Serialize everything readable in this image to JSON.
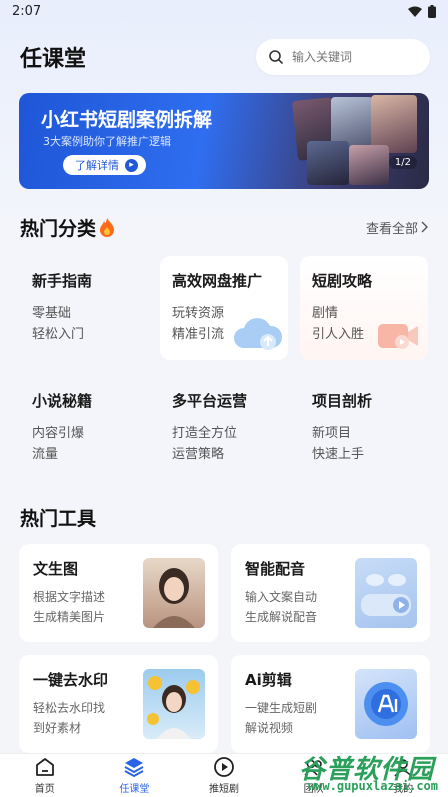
{
  "status_bar": {
    "time": "2:07"
  },
  "header": {
    "title": "任课堂",
    "search_placeholder": "输入关键词"
  },
  "banner": {
    "title": "小红书短剧案例拆解",
    "subtitle": "3大案例助你了解推广逻辑",
    "button_label": "了解详情",
    "pager": "1/2"
  },
  "hot_categories": {
    "title": "热门分类",
    "see_all": "查看全部",
    "items": [
      {
        "title": "新手指南",
        "line1": "零基础",
        "line2": "轻松入门"
      },
      {
        "title": "高效网盘推广",
        "line1": "玩转资源",
        "line2": "精准引流"
      },
      {
        "title": "短剧攻略",
        "line1": "剧情",
        "line2": "引人入胜"
      },
      {
        "title": "小说秘籍",
        "line1": "内容引爆",
        "line2": "流量"
      },
      {
        "title": "多平台运营",
        "line1": "打造全方位",
        "line2": "运营策略"
      },
      {
        "title": "项目剖析",
        "line1": "新项目",
        "line2": "快速上手"
      }
    ]
  },
  "hot_tools": {
    "title": "热门工具",
    "items": [
      {
        "title": "文生图",
        "line1": "根据文字描述",
        "line2": "生成精美图片"
      },
      {
        "title": "智能配音",
        "line1": "输入文案自动",
        "line2": "生成解说配音"
      },
      {
        "title": "一键去水印",
        "line1": "轻松去水印找",
        "line2": "到好素材"
      },
      {
        "title": "Ai剪辑",
        "line1": "一键生成短剧",
        "line2": "解说视频"
      }
    ]
  },
  "tabbar": {
    "items": [
      {
        "label": "首页"
      },
      {
        "label": "任课堂"
      },
      {
        "label": "推短剧"
      },
      {
        "label": "团队"
      },
      {
        "label": "我的"
      }
    ]
  },
  "watermark": {
    "text": "谷普软件园",
    "url": "www.gupuxlazai.com"
  },
  "colors": {
    "accent": "#2a63e8",
    "banner": "#1e56d6",
    "watermark": "#2aa05a"
  }
}
